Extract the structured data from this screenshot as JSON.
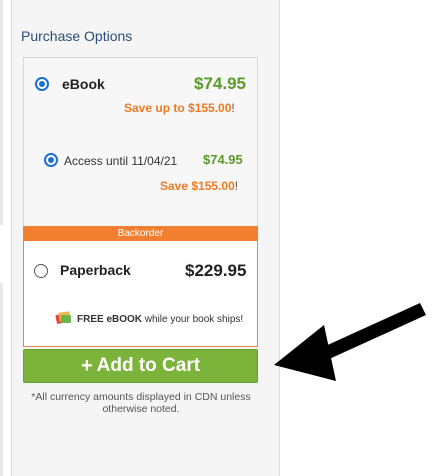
{
  "panel": {
    "title": "Purchase Options"
  },
  "options": {
    "ebook": {
      "label": "eBook",
      "price": "$74.95",
      "save_text": "Save up to $155.00",
      "save_suffix": "!",
      "selected": true
    },
    "access": {
      "label": "Access until 11/04/21",
      "price": "$74.95",
      "save_text": "Save $155.00",
      "save_suffix": "!",
      "selected": true
    }
  },
  "backorder": {
    "header": "Backorder",
    "paperback": {
      "label": "Paperback",
      "price": "$229.95",
      "selected": false
    },
    "free_ebook": {
      "bold": "FREE eBOOK",
      "rest": " while your book ships!"
    }
  },
  "cart": {
    "label": "Add to Cart",
    "plus": "+",
    "color": "#7cb33a"
  },
  "disclaimer": "*All currency amounts displayed in CDN unless otherwise noted.",
  "colors": {
    "accent_green": "#5b9a2a",
    "accent_orange": "#f07a23",
    "radio_blue": "#1a6fd6",
    "title_blue": "#2a4d7a"
  },
  "icons": {
    "free_ebook": "ebook-badge-icon",
    "pointer": "pointer-arrow-icon"
  }
}
